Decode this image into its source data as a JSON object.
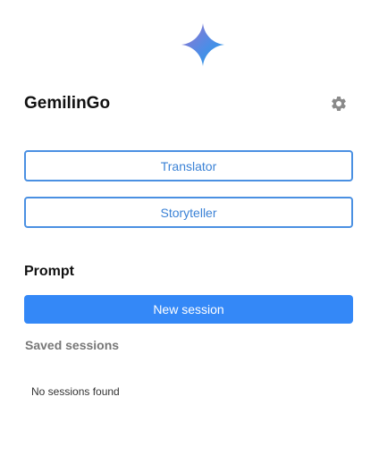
{
  "app": {
    "title": "GemilinGo",
    "logo_icon": "sparkle-icon",
    "settings_icon": "gear-icon"
  },
  "modes": {
    "translator_label": "Translator",
    "storyteller_label": "Storyteller"
  },
  "prompt": {
    "section_title": "Prompt",
    "new_session_label": "New session",
    "saved_sessions_title": "Saved sessions",
    "empty_message": "No sessions found"
  },
  "colors": {
    "accent": "#3488f7",
    "outline": "#4a90e2",
    "muted_text": "#777777"
  }
}
